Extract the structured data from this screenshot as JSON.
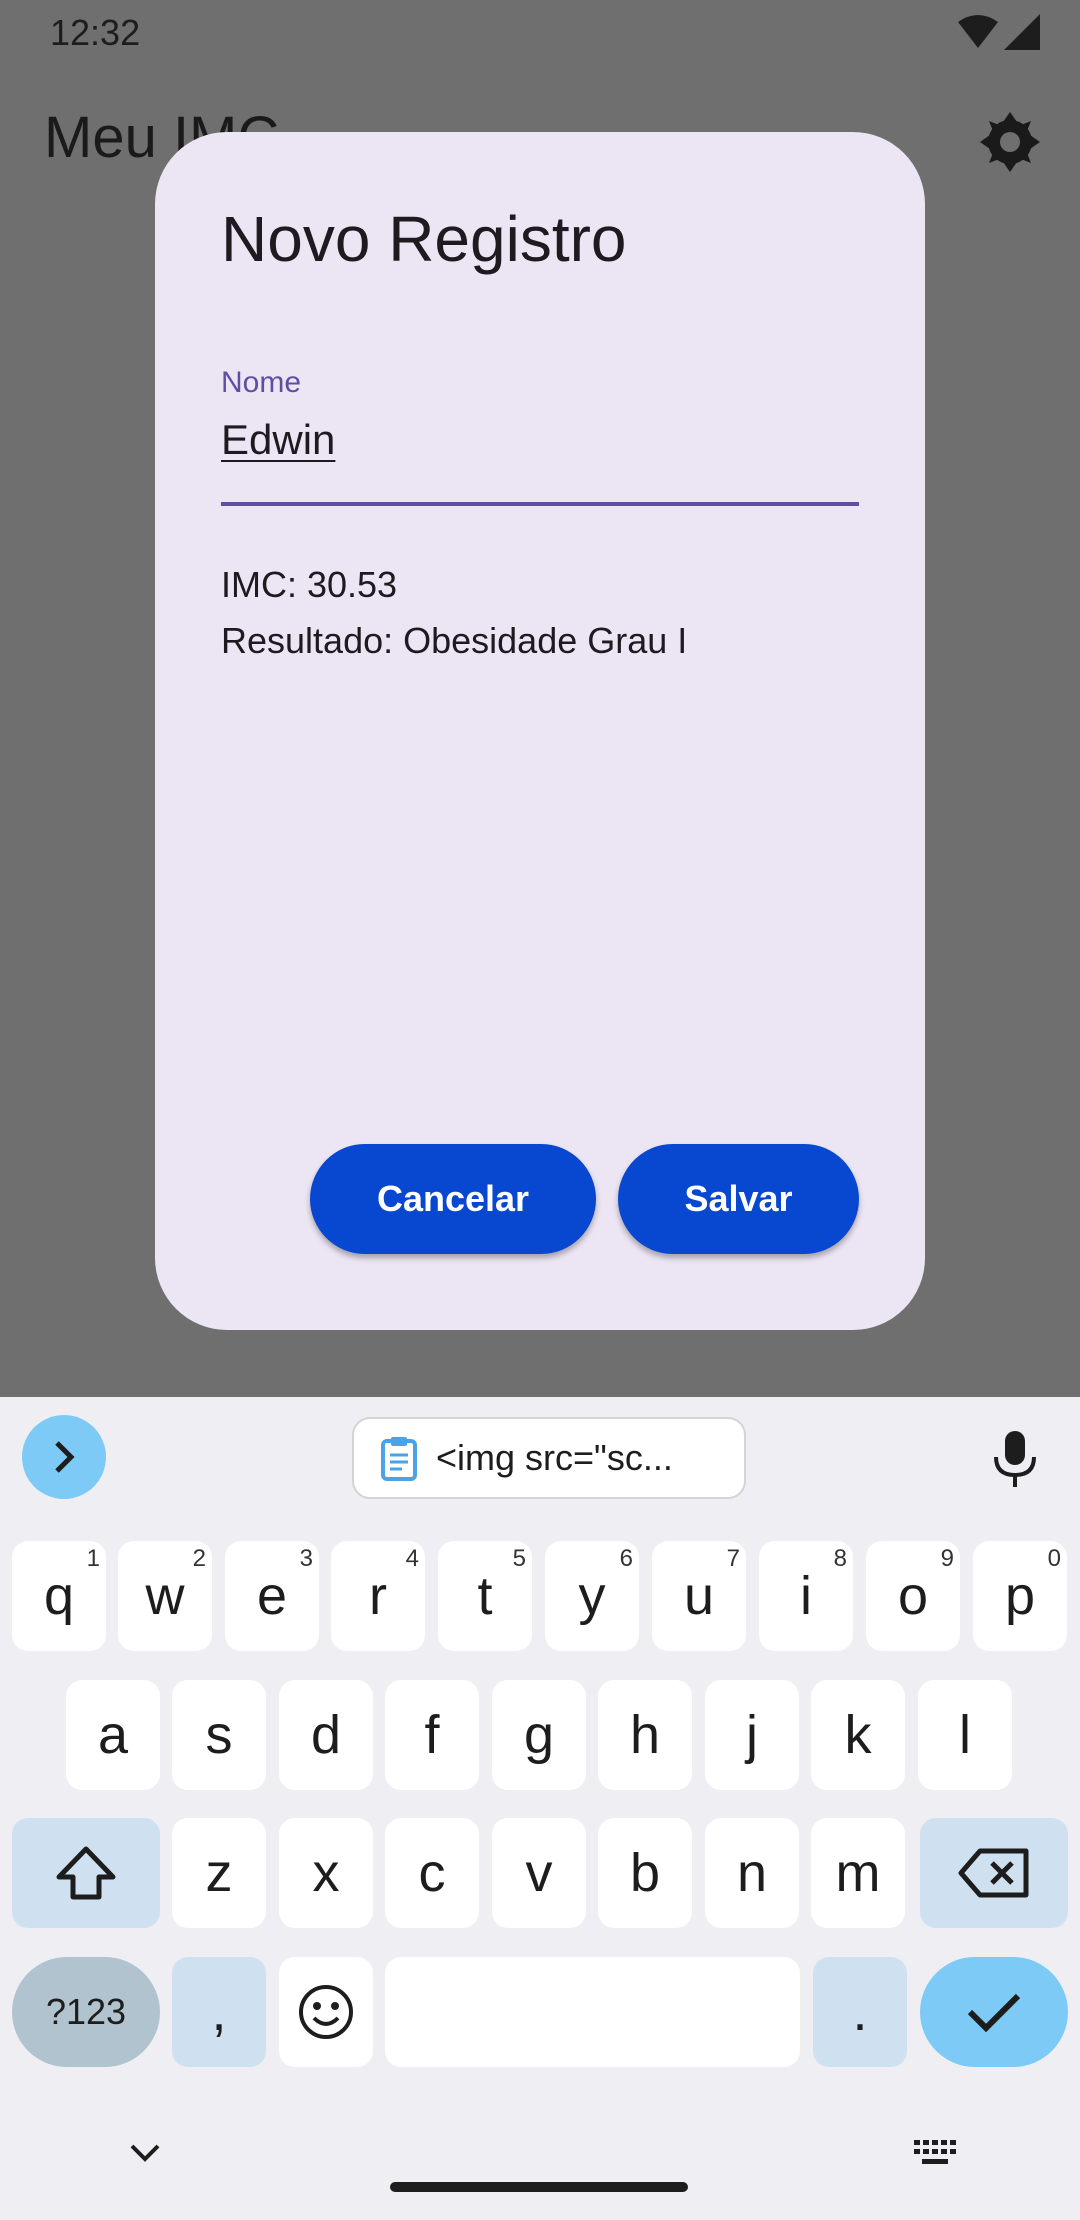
{
  "status_bar": {
    "time": "12:32",
    "icons": [
      "wifi-icon",
      "signal-icon"
    ]
  },
  "app_bar": {
    "title": "Meu IMC",
    "action_icon": "settings-icon"
  },
  "dialog": {
    "title": "Novo Registro",
    "name_field": {
      "label": "Nome",
      "value": "Edwin"
    },
    "imc_text": "IMC: 30.53",
    "result_text": "Resultado: Obesidade Grau I",
    "cancel_label": "Cancelar",
    "save_label": "Salvar"
  },
  "keyboard": {
    "clipboard_chip": "<img src=\"sc...",
    "row1": [
      {
        "key": "q",
        "hint": "1"
      },
      {
        "key": "w",
        "hint": "2"
      },
      {
        "key": "e",
        "hint": "3"
      },
      {
        "key": "r",
        "hint": "4"
      },
      {
        "key": "t",
        "hint": "5"
      },
      {
        "key": "y",
        "hint": "6"
      },
      {
        "key": "u",
        "hint": "7"
      },
      {
        "key": "i",
        "hint": "8"
      },
      {
        "key": "o",
        "hint": "9"
      },
      {
        "key": "p",
        "hint": "0"
      }
    ],
    "row2": [
      "a",
      "s",
      "d",
      "f",
      "g",
      "h",
      "j",
      "k",
      "l"
    ],
    "row3": [
      "z",
      "x",
      "c",
      "v",
      "b",
      "n",
      "m"
    ],
    "symbols_label": "?123",
    "comma": ",",
    "period": "."
  },
  "colors": {
    "accent": "#0847d0",
    "dialog_bg": "#ece6f4",
    "field_accent": "#5e4fa3",
    "scrim": "#6f6f6f"
  }
}
